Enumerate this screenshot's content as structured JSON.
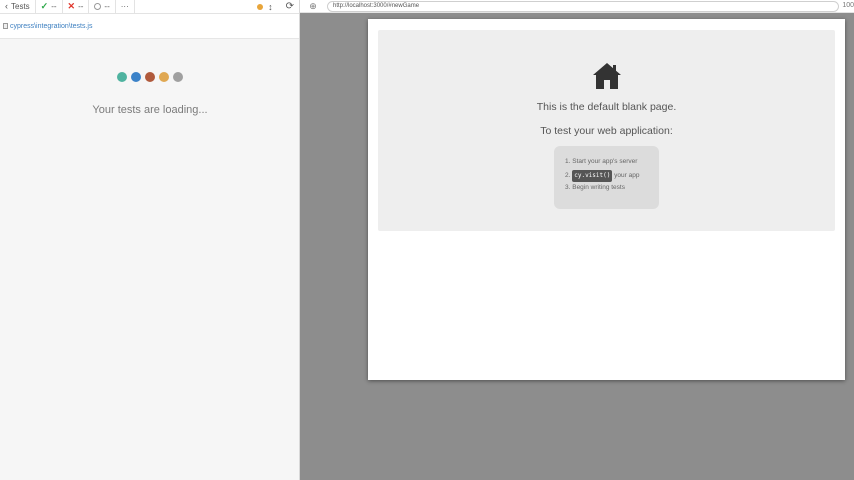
{
  "reporter": {
    "header": {
      "tests_label": "Tests",
      "passed": "--",
      "failed": "--",
      "pending": "--",
      "more": "···"
    },
    "spec_path": "cypress\\integration\\tests.js",
    "loader_colors": [
      "#4fb3a0",
      "#3b82c8",
      "#b05a3c",
      "#e0a852",
      "#a0a0a0"
    ],
    "loading_text": "Your tests are loading..."
  },
  "aut": {
    "url": "http://localhost:3000/#newGame",
    "zoom": "100",
    "blank_page": {
      "title": "This is the default blank page.",
      "subtitle": "To test your web application:",
      "steps": [
        {
          "num": "1.",
          "text": "Start your app's server"
        },
        {
          "num": "2.",
          "code": "cy.visit()",
          "text": "your app"
        },
        {
          "num": "3.",
          "text": "Begin writing tests"
        }
      ]
    }
  }
}
